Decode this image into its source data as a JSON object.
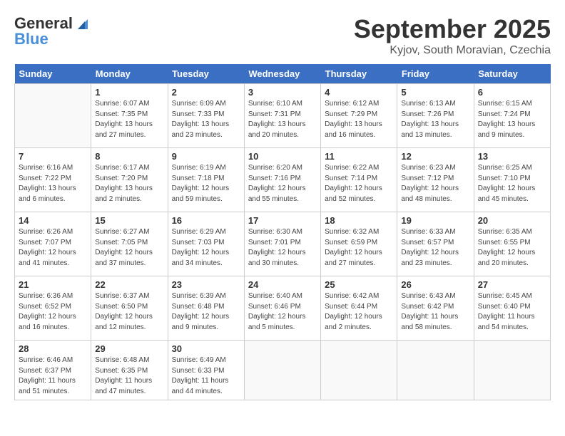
{
  "header": {
    "logo_line1": "General",
    "logo_line2": "Blue",
    "month": "September 2025",
    "location": "Kyjov, South Moravian, Czechia"
  },
  "weekdays": [
    "Sunday",
    "Monday",
    "Tuesday",
    "Wednesday",
    "Thursday",
    "Friday",
    "Saturday"
  ],
  "weeks": [
    [
      {
        "day": "",
        "info": ""
      },
      {
        "day": "1",
        "info": "Sunrise: 6:07 AM\nSunset: 7:35 PM\nDaylight: 13 hours\nand 27 minutes."
      },
      {
        "day": "2",
        "info": "Sunrise: 6:09 AM\nSunset: 7:33 PM\nDaylight: 13 hours\nand 23 minutes."
      },
      {
        "day": "3",
        "info": "Sunrise: 6:10 AM\nSunset: 7:31 PM\nDaylight: 13 hours\nand 20 minutes."
      },
      {
        "day": "4",
        "info": "Sunrise: 6:12 AM\nSunset: 7:29 PM\nDaylight: 13 hours\nand 16 minutes."
      },
      {
        "day": "5",
        "info": "Sunrise: 6:13 AM\nSunset: 7:26 PM\nDaylight: 13 hours\nand 13 minutes."
      },
      {
        "day": "6",
        "info": "Sunrise: 6:15 AM\nSunset: 7:24 PM\nDaylight: 13 hours\nand 9 minutes."
      }
    ],
    [
      {
        "day": "7",
        "info": "Sunrise: 6:16 AM\nSunset: 7:22 PM\nDaylight: 13 hours\nand 6 minutes."
      },
      {
        "day": "8",
        "info": "Sunrise: 6:17 AM\nSunset: 7:20 PM\nDaylight: 13 hours\nand 2 minutes."
      },
      {
        "day": "9",
        "info": "Sunrise: 6:19 AM\nSunset: 7:18 PM\nDaylight: 12 hours\nand 59 minutes."
      },
      {
        "day": "10",
        "info": "Sunrise: 6:20 AM\nSunset: 7:16 PM\nDaylight: 12 hours\nand 55 minutes."
      },
      {
        "day": "11",
        "info": "Sunrise: 6:22 AM\nSunset: 7:14 PM\nDaylight: 12 hours\nand 52 minutes."
      },
      {
        "day": "12",
        "info": "Sunrise: 6:23 AM\nSunset: 7:12 PM\nDaylight: 12 hours\nand 48 minutes."
      },
      {
        "day": "13",
        "info": "Sunrise: 6:25 AM\nSunset: 7:10 PM\nDaylight: 12 hours\nand 45 minutes."
      }
    ],
    [
      {
        "day": "14",
        "info": "Sunrise: 6:26 AM\nSunset: 7:07 PM\nDaylight: 12 hours\nand 41 minutes."
      },
      {
        "day": "15",
        "info": "Sunrise: 6:27 AM\nSunset: 7:05 PM\nDaylight: 12 hours\nand 37 minutes."
      },
      {
        "day": "16",
        "info": "Sunrise: 6:29 AM\nSunset: 7:03 PM\nDaylight: 12 hours\nand 34 minutes."
      },
      {
        "day": "17",
        "info": "Sunrise: 6:30 AM\nSunset: 7:01 PM\nDaylight: 12 hours\nand 30 minutes."
      },
      {
        "day": "18",
        "info": "Sunrise: 6:32 AM\nSunset: 6:59 PM\nDaylight: 12 hours\nand 27 minutes."
      },
      {
        "day": "19",
        "info": "Sunrise: 6:33 AM\nSunset: 6:57 PM\nDaylight: 12 hours\nand 23 minutes."
      },
      {
        "day": "20",
        "info": "Sunrise: 6:35 AM\nSunset: 6:55 PM\nDaylight: 12 hours\nand 20 minutes."
      }
    ],
    [
      {
        "day": "21",
        "info": "Sunrise: 6:36 AM\nSunset: 6:52 PM\nDaylight: 12 hours\nand 16 minutes."
      },
      {
        "day": "22",
        "info": "Sunrise: 6:37 AM\nSunset: 6:50 PM\nDaylight: 12 hours\nand 12 minutes."
      },
      {
        "day": "23",
        "info": "Sunrise: 6:39 AM\nSunset: 6:48 PM\nDaylight: 12 hours\nand 9 minutes."
      },
      {
        "day": "24",
        "info": "Sunrise: 6:40 AM\nSunset: 6:46 PM\nDaylight: 12 hours\nand 5 minutes."
      },
      {
        "day": "25",
        "info": "Sunrise: 6:42 AM\nSunset: 6:44 PM\nDaylight: 12 hours\nand 2 minutes."
      },
      {
        "day": "26",
        "info": "Sunrise: 6:43 AM\nSunset: 6:42 PM\nDaylight: 11 hours\nand 58 minutes."
      },
      {
        "day": "27",
        "info": "Sunrise: 6:45 AM\nSunset: 6:40 PM\nDaylight: 11 hours\nand 54 minutes."
      }
    ],
    [
      {
        "day": "28",
        "info": "Sunrise: 6:46 AM\nSunset: 6:37 PM\nDaylight: 11 hours\nand 51 minutes."
      },
      {
        "day": "29",
        "info": "Sunrise: 6:48 AM\nSunset: 6:35 PM\nDaylight: 11 hours\nand 47 minutes."
      },
      {
        "day": "30",
        "info": "Sunrise: 6:49 AM\nSunset: 6:33 PM\nDaylight: 11 hours\nand 44 minutes."
      },
      {
        "day": "",
        "info": ""
      },
      {
        "day": "",
        "info": ""
      },
      {
        "day": "",
        "info": ""
      },
      {
        "day": "",
        "info": ""
      }
    ]
  ]
}
